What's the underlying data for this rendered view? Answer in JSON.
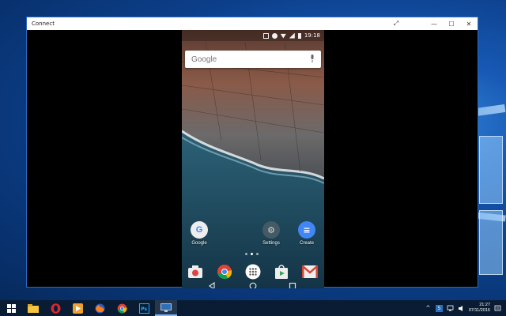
{
  "window": {
    "title": "Connect",
    "buttons": [
      "⤢",
      "—",
      "☐",
      "✕"
    ]
  },
  "phone": {
    "status": {
      "time": "19:18"
    },
    "search": {
      "placeholder": "Google"
    },
    "apps": [
      {
        "label": "Google"
      },
      {
        "label": "Settings"
      },
      {
        "label": "Create"
      }
    ],
    "dock": [
      "camera-icon",
      "chrome-icon",
      "app-drawer-icon",
      "play-store-icon",
      "gmail-icon"
    ],
    "nav": [
      "back-icon",
      "home-icon",
      "recents-icon"
    ]
  },
  "taskbar": {
    "pinned": [
      "start-icon",
      "file-explorer-icon",
      "opera-icon",
      "media-player-icon",
      "firefox-icon",
      "chrome-icon",
      "photoshop-icon",
      "connect-icon"
    ],
    "photoshop_label": "Ps",
    "clock": {
      "time": "21:27",
      "date": "07/11/2016"
    },
    "tray_badge": "5"
  }
}
